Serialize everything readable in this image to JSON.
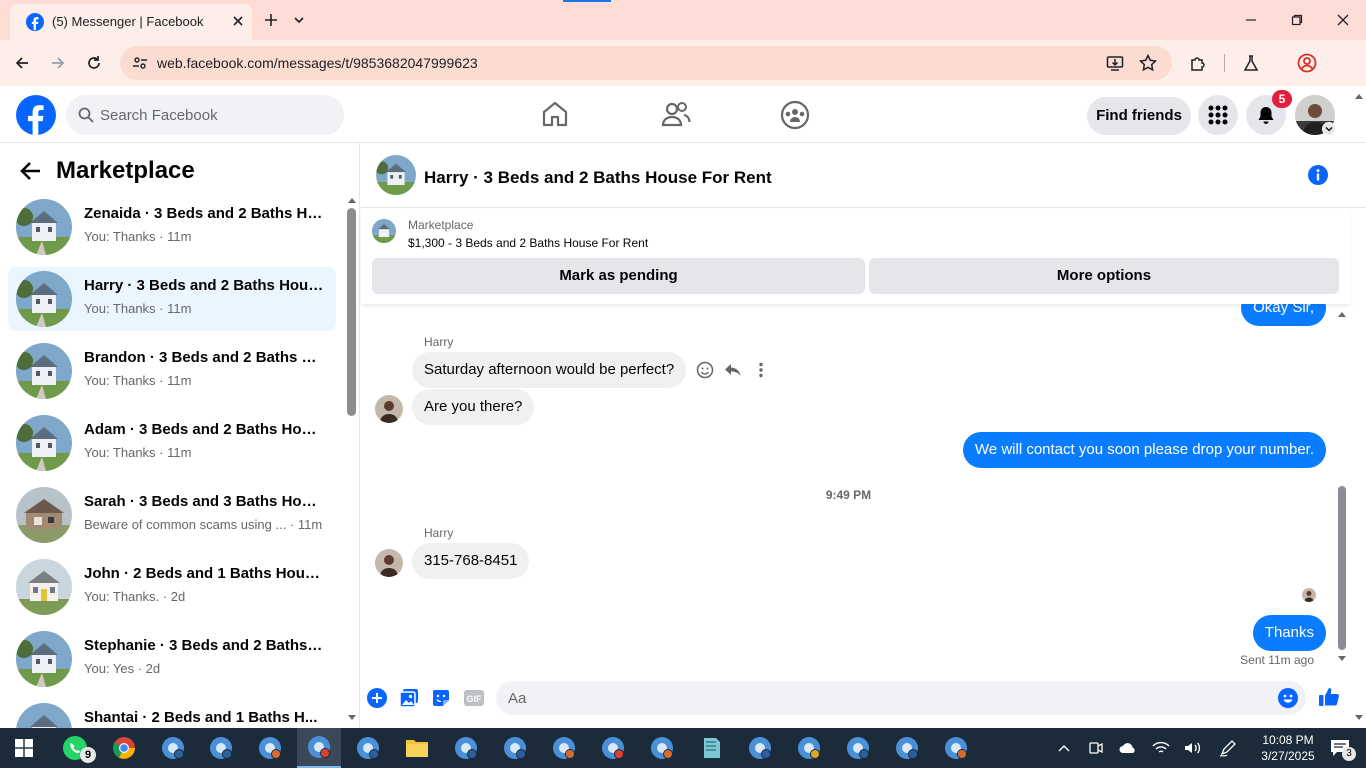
{
  "browser": {
    "tab_title": "(5) Messenger | Facebook",
    "url": "web.facebook.com/messages/t/9853682047999623"
  },
  "fb": {
    "search_placeholder": "Search Facebook",
    "find_friends": "Find friends",
    "notification_count": "5",
    "brand_color": "#0866ff"
  },
  "sidebar": {
    "title": "Marketplace",
    "chats": [
      {
        "name": "Zenaida · 3 Beds and 2 Baths Ho...",
        "sub": "You: Thanks · 11m",
        "thumb": "house-blue"
      },
      {
        "name": "Harry · 3 Beds and 2 Baths Hous...",
        "sub": "You: Thanks · 11m",
        "thumb": "house-blue"
      },
      {
        "name": "Brandon · 3 Beds and 2 Baths H...",
        "sub": "You: Thanks · 11m",
        "thumb": "house-blue"
      },
      {
        "name": "Adam · 3 Beds and 2 Baths Hous...",
        "sub": "You: Thanks · 11m",
        "thumb": "house-blue"
      },
      {
        "name": "Sarah · 3 Beds and 3 Baths Hous...",
        "sub": "Beware of common scams using ... · 11m",
        "thumb": "house-brick"
      },
      {
        "name": "John · 2 Beds and 1 Baths House...",
        "sub": "You: Thanks. · 2d",
        "thumb": "house-yellow"
      },
      {
        "name": "Stephanie · 3 Beds and 2 Baths ...",
        "sub": "You: Yes · 2d",
        "thumb": "house-blue"
      },
      {
        "name": "Shantai · 2 Beds and 1 Baths H...",
        "sub": "",
        "thumb": "house-blue"
      }
    ]
  },
  "conversation": {
    "title": "Harry · 3 Beds and 2 Baths House For Rent",
    "listing_label": "Marketplace",
    "listing_price": "$1,300 - 3 Beds and 2 Baths House For Rent",
    "mark_pending": "Mark as pending",
    "more_options": "More options",
    "partial_top": "Okay Sir,",
    "msg_sender_1": "Harry",
    "msg_in_1": "Saturday afternoon would be perfect?",
    "msg_in_2": "Are you there?",
    "msg_out_1": "We will contact you soon please drop your number.",
    "time_separator": "9:49 PM",
    "msg_sender_2": "Harry",
    "msg_in_3": "315-768-8451",
    "msg_out_2": "Thanks",
    "sent_status": "Sent 11m ago",
    "composer_placeholder": "Aa"
  },
  "taskbar": {
    "whatsapp_badge": "9",
    "time": "10:08 PM",
    "date": "3/27/2025",
    "notif_count": "3"
  }
}
